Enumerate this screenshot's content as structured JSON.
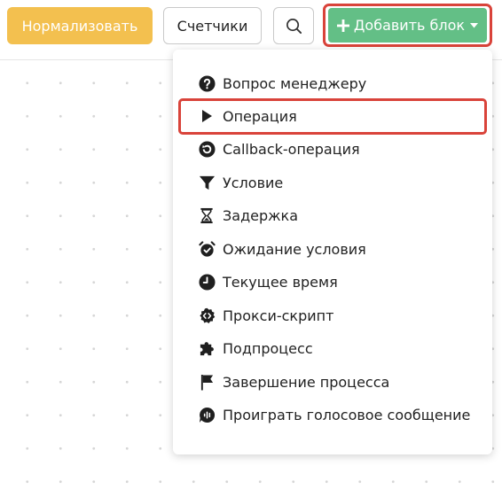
{
  "toolbar": {
    "normalize_label": "Нормализовать",
    "counters_label": "Счетчики",
    "search_icon": "search-icon",
    "add_block_label": "Добавить блок"
  },
  "colors": {
    "normalize_button": "#f3c04f",
    "add_button": "#63bf86",
    "highlight_border": "#d9433a",
    "text": "#222222"
  },
  "menu": {
    "items": [
      {
        "label": "Вопрос менеджеру",
        "icon": "question-circle-icon"
      },
      {
        "label": "Операция",
        "icon": "play-icon",
        "highlighted": true
      },
      {
        "label": "Callback-операция",
        "icon": "callback-circle-icon"
      },
      {
        "label": "Условие",
        "icon": "filter-icon"
      },
      {
        "label": "Задержка",
        "icon": "hourglass-icon"
      },
      {
        "label": "Ожидание условия",
        "icon": "alarm-clock-icon"
      },
      {
        "label": "Текущее время",
        "icon": "clock-icon"
      },
      {
        "label": "Прокси-скрипт",
        "icon": "code-gear-icon"
      },
      {
        "label": "Подпроцесс",
        "icon": "puzzle-icon"
      },
      {
        "label": "Завершение процесса",
        "icon": "flag-icon"
      },
      {
        "label": "Проиграть голосовое сообщение",
        "icon": "voice-message-icon"
      }
    ]
  }
}
